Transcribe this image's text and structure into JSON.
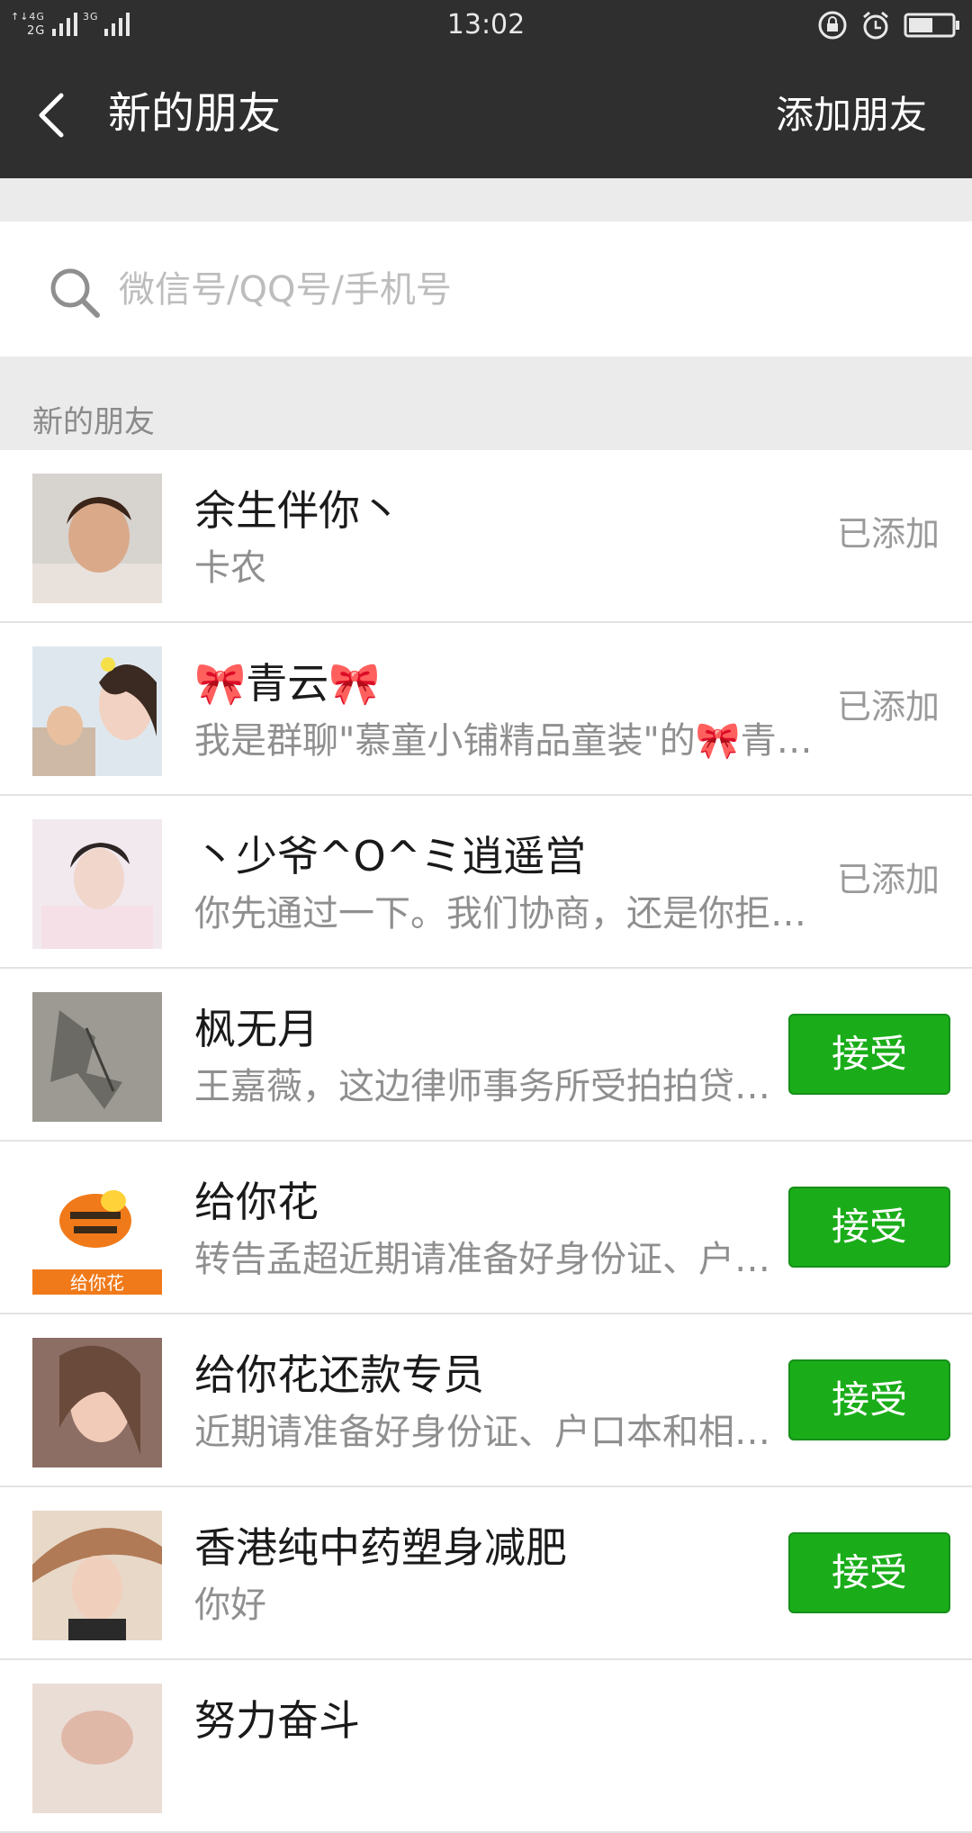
{
  "status_bar": {
    "signal_text": "4G 2G 3G",
    "time": "13:02"
  },
  "header": {
    "back_icon": "chevron-left-icon",
    "title": "新的朋友",
    "action_label": "添加朋友"
  },
  "search": {
    "icon": "search-icon",
    "placeholder": "微信号/QQ号/手机号"
  },
  "section_label": "新的朋友",
  "requests": [
    {
      "name": "余生伴你丶",
      "message": "卡农",
      "status": "已添加",
      "avatar_color": "#c9b49a"
    },
    {
      "name": "🎀青云🎀",
      "message": "我是群聊\"慕童小铺精品童装\"的🎀青…",
      "status": "已添加",
      "avatar_color": "#d9c9b8"
    },
    {
      "name": "丶少爷^O^ミ逍遥営",
      "message": "你先通过一下。我们协商，还是你拒…",
      "status": "已添加",
      "avatar_color": "#e6d6dc"
    },
    {
      "name": "枫无月",
      "message": "王嘉薇，这边律师事务所受拍拍贷…",
      "status": "接受",
      "avatar_color": "#8a8a82"
    },
    {
      "name": "给你花",
      "message": "转告孟超近期请准备好身份证、户…",
      "status": "接受",
      "avatar_color": "#f07a1a"
    },
    {
      "name": "给你花还款专员",
      "message": "近期请准备好身份证、户口本和相…",
      "status": "接受",
      "avatar_color": "#b08a78"
    },
    {
      "name": "香港纯中药塑身减肥",
      "message": "你好",
      "status": "接受",
      "avatar_color": "#c48a66"
    },
    {
      "name": "努力奋斗",
      "message": "",
      "status": "",
      "avatar_color": "#e2cfc8"
    }
  ],
  "colors": {
    "header_bg": "#2f2f2f",
    "accept_green": "#1aad19",
    "page_bg": "#ebebeb"
  }
}
